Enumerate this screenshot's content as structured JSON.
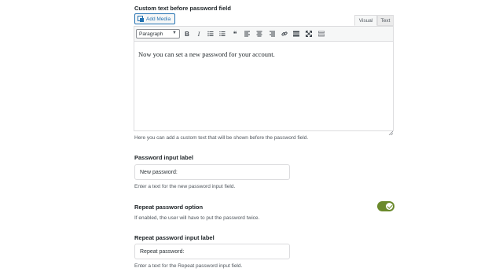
{
  "custom_text": {
    "label": "Custom text before password field",
    "add_media_label": "Add Media",
    "tabs": {
      "visual": "Visual",
      "text": "Text"
    },
    "format_select": "Paragraph",
    "toolbar_icons": [
      "bold-icon",
      "italic-icon",
      "bulleted-list-icon",
      "numbered-list-icon",
      "blockquote-icon",
      "align-left-icon",
      "align-center-icon",
      "align-right-icon",
      "link-icon",
      "read-more-icon",
      "fullscreen-icon",
      "toolbar-toggle-icon"
    ],
    "toolbar_glyphs": {
      "bold": "B",
      "italic": "I",
      "blockquote": "❝"
    },
    "content": "Now you can set a new password for your account.",
    "help": "Here you can add a custom text that will be shown before the password field."
  },
  "password_label": {
    "label": "Password input label",
    "value": "New password:",
    "help": "Enter a text for the new password input field."
  },
  "repeat_option": {
    "label": "Repeat password option",
    "enabled": true,
    "help": "If enabled, the user will have to put the password twice.",
    "toggle_color": "#6b8a2c"
  },
  "repeat_label": {
    "label": "Repeat password input label",
    "value": "Repeat password:",
    "help": "Enter a text for the Repeat password input field."
  }
}
